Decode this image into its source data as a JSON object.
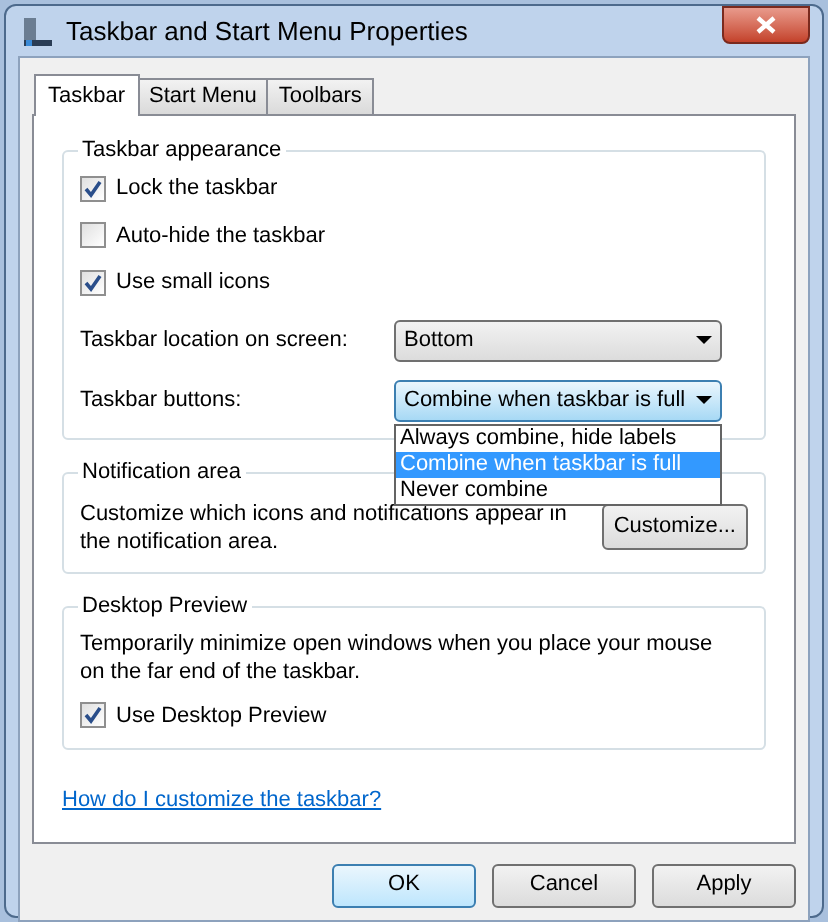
{
  "window": {
    "title": "Taskbar and Start Menu Properties"
  },
  "tabs": [
    {
      "label": "Taskbar",
      "selected": true
    },
    {
      "label": "Start Menu",
      "selected": false
    },
    {
      "label": "Toolbars",
      "selected": false
    }
  ],
  "appearance": {
    "title": "Taskbar appearance",
    "checkboxes": [
      {
        "label": "Lock the taskbar",
        "checked": true
      },
      {
        "label": "Auto-hide the taskbar",
        "checked": false
      },
      {
        "label": "Use small icons",
        "checked": true
      }
    ],
    "location": {
      "label": "Taskbar location on screen:",
      "value": "Bottom"
    },
    "buttons_setting": {
      "label": "Taskbar buttons:",
      "value": "Combine when taskbar is full",
      "expanded": true,
      "options": [
        {
          "label": "Always combine, hide labels",
          "selected": false
        },
        {
          "label": "Combine when taskbar is full",
          "selected": true
        },
        {
          "label": "Never combine",
          "selected": false
        }
      ]
    }
  },
  "notification": {
    "title": "Notification area",
    "text": "Customize which icons and notifications appear in the notification area.",
    "button": "Customize..."
  },
  "preview": {
    "title": "Desktop Preview",
    "text": "Temporarily minimize open windows when you place your mouse on the far end of the taskbar.",
    "checkbox": {
      "label": "Use Desktop Preview",
      "checked": true
    }
  },
  "help_link": "How do I customize the taskbar?",
  "buttons": [
    {
      "label": "OK",
      "default": true
    },
    {
      "label": "Cancel",
      "default": false
    },
    {
      "label": "Apply",
      "default": false
    }
  ]
}
